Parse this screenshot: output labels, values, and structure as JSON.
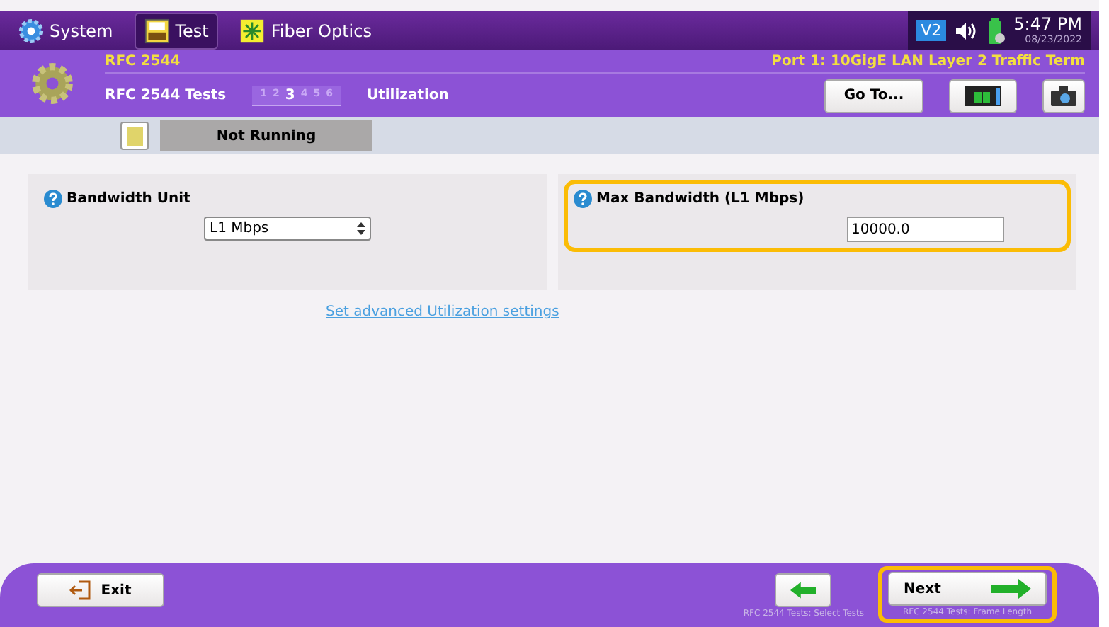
{
  "top_tabs": [
    {
      "label": "System",
      "kind": "gear",
      "selected": false
    },
    {
      "label": "Test",
      "kind": "bert",
      "selected": true
    },
    {
      "label": "Fiber Optics",
      "kind": "laser",
      "selected": false
    }
  ],
  "status_tray": {
    "badge": "V2",
    "time": "5:47 PM",
    "date": "08/23/2022"
  },
  "header": {
    "title": "RFC 2544",
    "port": "Port 1: 10GigE LAN Layer 2 Traffic Term",
    "section": "RFC 2544 Tests",
    "steps": [
      {
        "label": "1",
        "selected": false
      },
      {
        "label": "2",
        "selected": false
      },
      {
        "label": "3",
        "selected": true
      },
      {
        "label": "4",
        "selected": false
      },
      {
        "label": "5",
        "selected": false
      },
      {
        "label": "6",
        "selected": false
      }
    ],
    "page": "Utilization",
    "goto": "Go To..."
  },
  "run_status": "Not Running",
  "panels": [
    {
      "label": "Bandwidth Unit",
      "kind": "select",
      "value": "L1 Mbps",
      "highlighted": false
    },
    {
      "label": "Max Bandwidth (L1 Mbps)",
      "kind": "input",
      "value": "10000.0",
      "highlighted": true
    }
  ],
  "advanced_link": "Set advanced Utilization settings",
  "footer": {
    "exit": "Exit",
    "back_caption": "RFC 2544 Tests: Select Tests",
    "next": "Next",
    "next_caption": "RFC 2544 Tests: Frame Length",
    "next_highlighted": true
  }
}
